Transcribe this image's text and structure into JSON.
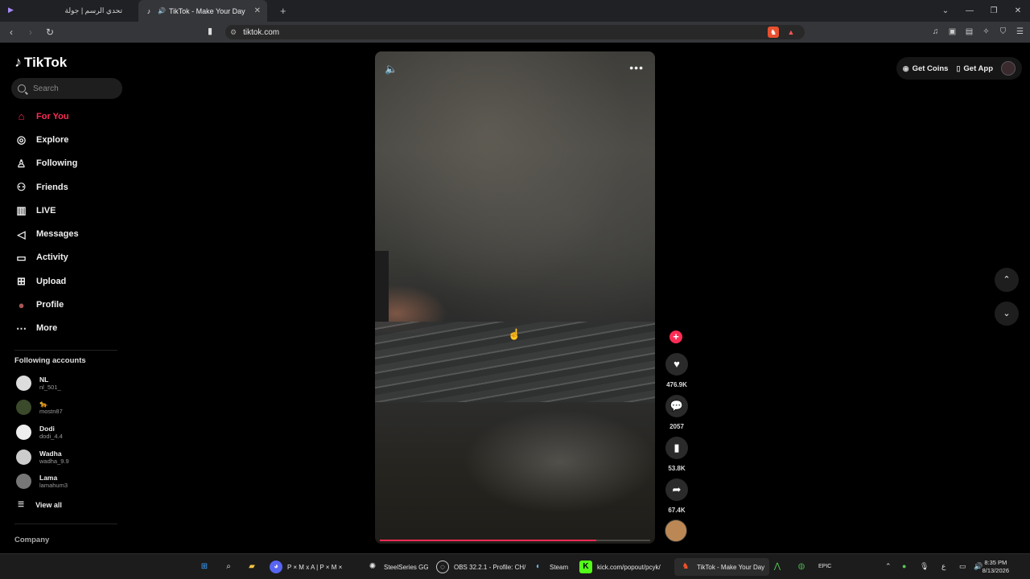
{
  "browser": {
    "tabs": [
      {
        "label": "تحدي الرسم | جولة",
        "active": false
      },
      {
        "label": "TikTok - Make Your Day",
        "active": true
      }
    ],
    "url": "tiktok.com"
  },
  "sidebar": {
    "logo": "TikTok",
    "search_placeholder": "Search",
    "nav": [
      {
        "label": "For You",
        "icon": "home-icon",
        "active": true
      },
      {
        "label": "Explore",
        "icon": "compass-icon"
      },
      {
        "label": "Following",
        "icon": "following-icon"
      },
      {
        "label": "Friends",
        "icon": "friends-icon"
      },
      {
        "label": "LIVE",
        "icon": "live-icon"
      },
      {
        "label": "Messages",
        "icon": "messages-icon"
      },
      {
        "label": "Activity",
        "icon": "activity-icon"
      },
      {
        "label": "Upload",
        "icon": "upload-icon"
      },
      {
        "label": "Profile",
        "icon": "profile-icon"
      },
      {
        "label": "More",
        "icon": "more-icon"
      }
    ],
    "following_title": "Following accounts",
    "accounts": [
      {
        "name": "NL",
        "handle": "nl_501_"
      },
      {
        "name": "🐆",
        "handle": "mostn87"
      },
      {
        "name": "Dodi",
        "handle": "dodi_4.4"
      },
      {
        "name": "Wadha",
        "handle": "wadha_9.9"
      },
      {
        "name": "Lama",
        "handle": "lamahum3"
      }
    ],
    "view_all": "View all",
    "company": "Company"
  },
  "video": {
    "progress": 0.8
  },
  "actions": {
    "likes": "476.9K",
    "comments": "2057",
    "saves": "53.8K",
    "shares": "67.4K"
  },
  "topright": {
    "get_coins": "Get Coins",
    "get_app": "Get App"
  },
  "taskbar": {
    "items": [
      "P × M x A | P × M ×",
      "SteelSeries GG",
      "OBS 32.2.1 - Profile: CH/",
      "Steam",
      "kick.com/popout/pcyk/",
      "TikTok - Make Your Day"
    ],
    "lang": "ع",
    "time": "8:35 PM",
    "date": "8/13/2026"
  }
}
